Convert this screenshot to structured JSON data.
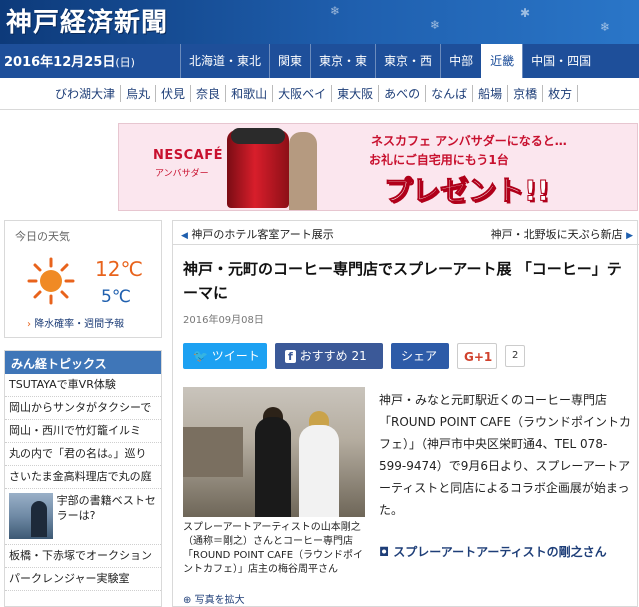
{
  "site": {
    "logo": "神戸経済新聞"
  },
  "navbar": {
    "date": "2016年12月25日",
    "dow": "(日)",
    "regions": [
      "北海道・東北",
      "関東",
      "東京・東",
      "東京・西",
      "中部",
      "近畿",
      "中国・四国"
    ],
    "active_region": "近畿"
  },
  "areas": [
    "びわ湖大津",
    "烏丸",
    "伏見",
    "奈良",
    "和歌山",
    "大阪ベイ",
    "東大阪",
    "あべの",
    "なんば",
    "船場",
    "京橋",
    "枚方"
  ],
  "ad": {
    "brand": "NESCAFÉ",
    "brand_sub": "アンバサダー",
    "line1": "ネスカフェ アンバサダーになると…",
    "line2": "お礼にご自宅用にもう1台",
    "headline": "プレゼント!!"
  },
  "weather": {
    "title": "今日の天気",
    "high": "12℃",
    "low": "5℃",
    "link": "降水確率・週間予報",
    "icon": "sun-icon"
  },
  "topics": {
    "title": "みん経トピックス",
    "items": [
      "TSUTAYAで車VR体験",
      "岡山からサンタがタクシーで",
      "岡山・西川で竹灯籠イルミ",
      "丸の内で「君の名は。」巡り",
      "さいたま金高料理店で丸の庭"
    ],
    "featured": "宇部の書籍ベストセラーは?",
    "items2": [
      "板橋・下赤塚でオークション",
      "パークレンジャー実験室"
    ]
  },
  "article": {
    "prev": "神戸のホテル客室アート展示",
    "next": "神戸・北野坂に天ぷら新店",
    "headline": "神戸・元町のコーヒー専門店でスプレーアート展 「コーヒー」テーマに",
    "date": "2016年09月08日",
    "share": {
      "tweet": "ツイート",
      "like": "おすすめ 21",
      "share": "シェア",
      "gplus": "G+1",
      "gplus_count": "2"
    },
    "caption": "スプレーアートアーティストの山本剛之（通称＝剛之）さんとコーヒー専門店「ROUND POINT CAFE（ラウンドポイントカフェ）」店主の梅谷周平さん",
    "enlarge": "写真を拡大",
    "body": "神戸・みなと元町駅近くのコーヒー専門店「ROUND POINT CAFE（ラウンドポイントカフェ）」（神戸市中央区栄町通4、TEL 078-599-9474）で9月6日より、スプレーアートアーティストと同店によるコラボ企画展が始まった。",
    "subhead": "スプレーアートアーティストの剛之さん"
  }
}
